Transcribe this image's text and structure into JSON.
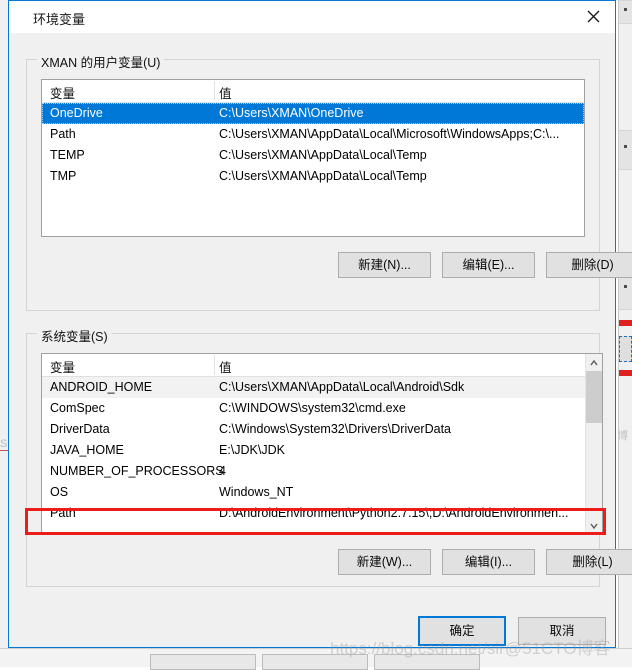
{
  "window": {
    "title": "环境变量",
    "close_icon": "close-icon"
  },
  "user_section": {
    "legend": "XMAN 的用户变量(U)",
    "columns": {
      "name": "变量",
      "value": "值"
    },
    "rows": [
      {
        "name": "OneDrive",
        "value": "C:\\Users\\XMAN\\OneDrive",
        "state": "selected"
      },
      {
        "name": "Path",
        "value": "C:\\Users\\XMAN\\AppData\\Local\\Microsoft\\WindowsApps;C:\\...",
        "state": ""
      },
      {
        "name": "TEMP",
        "value": "C:\\Users\\XMAN\\AppData\\Local\\Temp",
        "state": ""
      },
      {
        "name": "TMP",
        "value": "C:\\Users\\XMAN\\AppData\\Local\\Temp",
        "state": ""
      }
    ],
    "buttons": {
      "new": "新建(N)...",
      "edit": "编辑(E)...",
      "delete": "删除(D)"
    }
  },
  "system_section": {
    "legend": "系统变量(S)",
    "columns": {
      "name": "变量",
      "value": "值"
    },
    "rows": [
      {
        "name": "ANDROID_HOME",
        "value": "C:\\Users\\XMAN\\AppData\\Local\\Android\\Sdk",
        "state": "hover"
      },
      {
        "name": "ComSpec",
        "value": "C:\\WINDOWS\\system32\\cmd.exe",
        "state": ""
      },
      {
        "name": "DriverData",
        "value": "C:\\Windows\\System32\\Drivers\\DriverData",
        "state": ""
      },
      {
        "name": "JAVA_HOME",
        "value": "E:\\JDK\\JDK",
        "state": ""
      },
      {
        "name": "NUMBER_OF_PROCESSORS",
        "value": "4",
        "state": ""
      },
      {
        "name": "OS",
        "value": "Windows_NT",
        "state": ""
      },
      {
        "name": "Path",
        "value": "D:\\AndroidEnvironment\\Python2.7.15\\;D:\\AndroidEnvironmen...",
        "state": "highlighted"
      }
    ],
    "buttons": {
      "new": "新建(W)...",
      "edit": "编辑(I)...",
      "delete": "删除(L)"
    },
    "scroll": {
      "up_arrow": "chevron-up-icon",
      "down_arrow": "chevron-down-icon"
    }
  },
  "footer": {
    "ok": "确定",
    "cancel": "取消"
  },
  "annotation": {
    "color": "#ee1b1b",
    "target": "Path"
  },
  "watermark": {
    "text": "https://blog.csdn.net/sir@51CTO博客"
  },
  "colors": {
    "accent": "#0078d7",
    "selection": "#0078d7",
    "dialog_bg": "#f0f0f0",
    "annotation_red": "#ee1b1b"
  }
}
